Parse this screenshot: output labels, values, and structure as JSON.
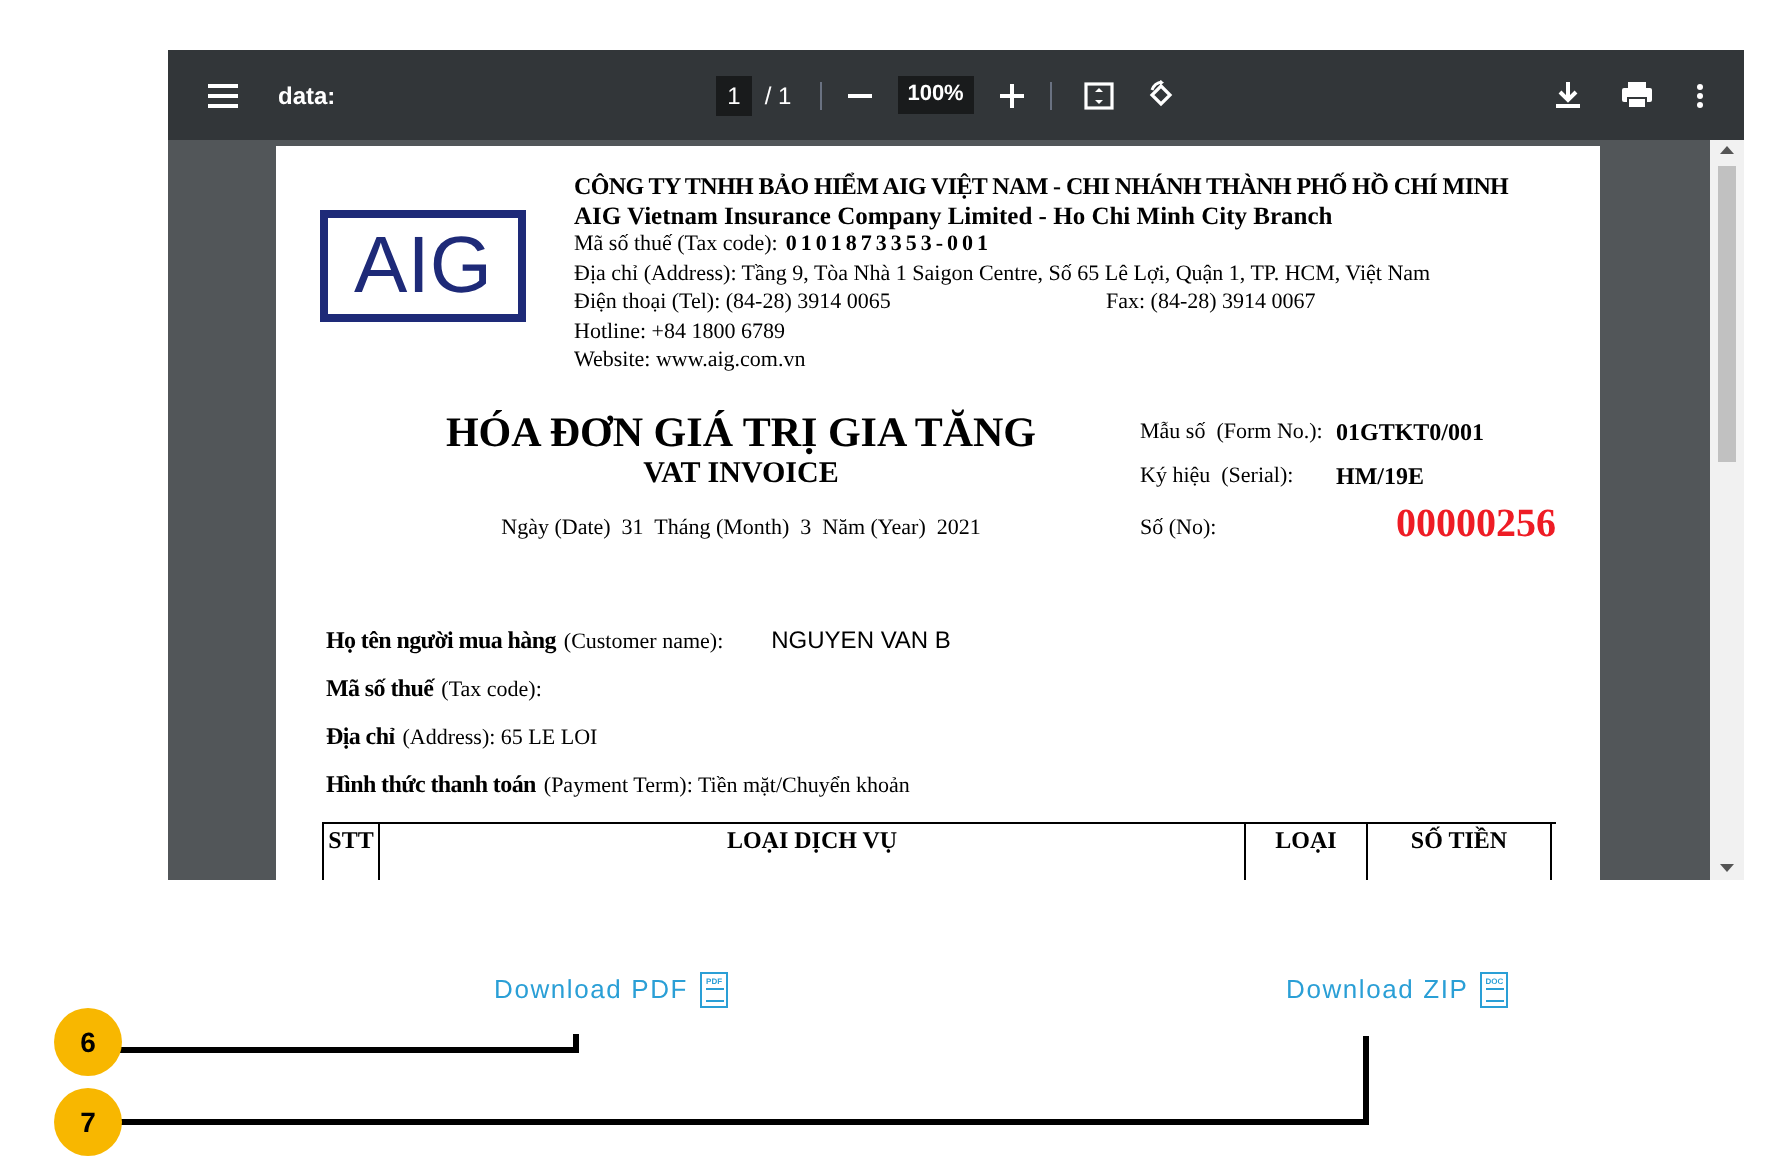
{
  "viewer": {
    "title": "data:",
    "page_current": "1",
    "page_total": "/ 1",
    "zoom": "100%"
  },
  "invoice": {
    "logo": "AIG",
    "company_vi": "CÔNG TY TNHH BẢO HIỂM AIG VIỆT NAM - CHI NHÁNH THÀNH PHỐ HỒ CHÍ MINH",
    "company_en": "AIG Vietnam Insurance Company Limited - Ho Chi Minh City Branch",
    "tax_code_label": "Mã số thuế (Tax code):",
    "tax_code": "0101873353-001",
    "address": "Địa chỉ (Address): Tầng 9, Tòa Nhà 1 Saigon Centre, Số 65 Lê Lợi, Quận 1, TP. HCM, Việt Nam",
    "phone": "Điện thoại (Tel): (84-28) 3914 0065",
    "fax": "Fax: (84-28) 3914 0067",
    "hotline": "Hotline: +84 1800 6789",
    "website": "Website: www.aig.com.vn",
    "title_vi": "HÓA ĐƠN GIÁ TRỊ GIA TĂNG",
    "title_en": "VAT INVOICE",
    "date_line": "Ngày (Date)  31  Tháng (Month)  3  Năm (Year)  2021",
    "meta": [
      {
        "label": "Mẫu số  (Form No.):",
        "value": "01GTKT0/001",
        "kind": "plain"
      },
      {
        "label": "Ký hiệu  (Serial):",
        "value": "HM/19E",
        "kind": "plain"
      },
      {
        "label": "Số (No):",
        "value": "00000256",
        "kind": "number"
      }
    ],
    "buyer": [
      {
        "label": "Họ tên người mua hàng",
        "hint": "(Customer name):",
        "value": "NGUYEN VAN B",
        "kind": "typed"
      },
      {
        "label": "Mã số thuế",
        "hint": "(Tax code):",
        "kind": "plain"
      },
      {
        "label": "Địa chỉ",
        "hint": "(Address): 65 LE LOI",
        "kind": "plain"
      },
      {
        "label": "Hình thức thanh toán",
        "hint": "(Payment Term): Tiền mặt/Chuyển khoản",
        "kind": "plain"
      }
    ],
    "table_columns": [
      "STT",
      "LOẠI DỊCH VỤ",
      "LOẠI",
      "SỐ TIỀN"
    ]
  },
  "downloads": [
    {
      "label": "Download PDF",
      "icon_text": "PDF"
    },
    {
      "label": "Download ZIP",
      "icon_text": "DOC"
    }
  ],
  "callouts": [
    {
      "number": "6"
    },
    {
      "number": "7"
    }
  ]
}
